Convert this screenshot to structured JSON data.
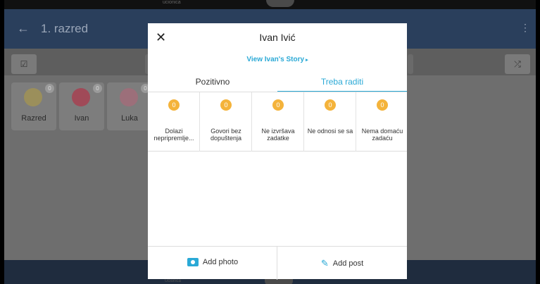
{
  "status_bar": {
    "tiny_text": "ucionica"
  },
  "app_bar": {
    "back_icon": "←",
    "title": "1. razred",
    "menu_icon": "⋮"
  },
  "toolbar": {
    "left_icon": "☑",
    "right_icon": "⤮"
  },
  "students": [
    {
      "name": "Razred",
      "badge": "0",
      "color": "#9b8f5b"
    },
    {
      "name": "Ivan",
      "badge": "0",
      "color": "#a04a58"
    },
    {
      "name": "Luka",
      "badge": "0",
      "color": "#9c6f7a"
    }
  ],
  "bottom": {
    "tiny_text": "Učionica"
  },
  "modal": {
    "close_icon": "✕",
    "title": "Ivan Ivić",
    "story_link": "View Ivan's Story",
    "story_arrow": "▸",
    "tabs": [
      {
        "label": "Pozitivno",
        "active": false
      },
      {
        "label": "Treba raditi",
        "active": true
      }
    ],
    "skills": [
      {
        "count": "0",
        "label": "Dolazi nepripremlje..."
      },
      {
        "count": "0",
        "label": "Govori bez dopuštenja"
      },
      {
        "count": "0",
        "label": "Ne izvršava zadatke"
      },
      {
        "count": "0",
        "label": "Ne odnosi se sa"
      },
      {
        "count": "0",
        "label": "Nema domaću zadaću"
      }
    ],
    "add_photo": "Add photo",
    "add_post": "Add post",
    "pen_icon": "✎"
  },
  "colors": {
    "accent": "#2aa9d6",
    "badge": "#f4b33b",
    "app_bar": "#2a3f5c"
  }
}
